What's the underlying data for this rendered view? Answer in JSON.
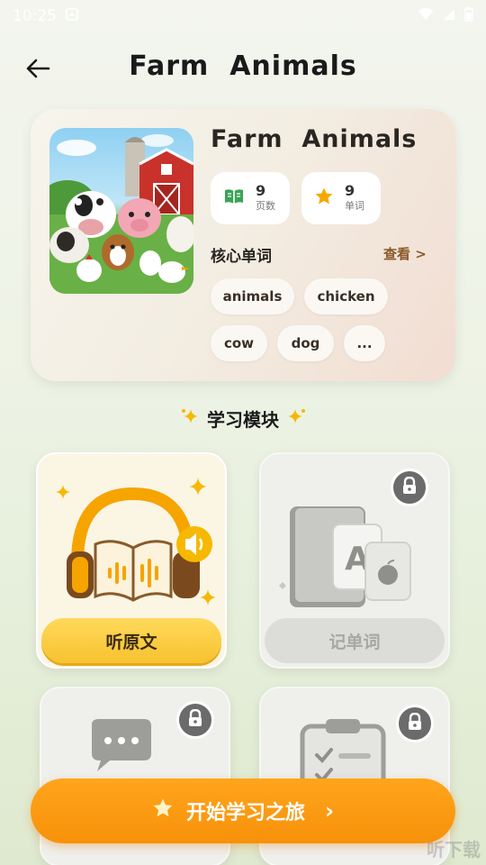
{
  "status_bar": {
    "time": "10:25"
  },
  "header": {
    "title": "Farm  Animals"
  },
  "book": {
    "title": "Farm  Animals",
    "stats": [
      {
        "value": "9",
        "label": "页数",
        "icon": "book-icon",
        "color": "#3aa457"
      },
      {
        "value": "9",
        "label": "单词",
        "icon": "star-icon",
        "color": "#f6a800"
      }
    ],
    "core_words_label": "核心单词",
    "view_label": "查看 >",
    "words": [
      "animals",
      "chicken",
      "cow",
      "dog",
      "..."
    ]
  },
  "section": {
    "title": "学习模块"
  },
  "modules": [
    {
      "label": "听原文",
      "locked": false,
      "icon": "headphones-book-icon"
    },
    {
      "label": "记单词",
      "locked": true,
      "icon": "flashcards-book-icon"
    },
    {
      "label": "",
      "locked": true,
      "icon": "chat-bubble-icon"
    },
    {
      "label": "",
      "locked": true,
      "icon": "clipboard-icon"
    }
  ],
  "start_button": {
    "label": "开始学习之旅",
    "arrow": "›"
  },
  "watermark": "听下载",
  "colors": {
    "accent": "#f7910a",
    "active_button": "#f7c230"
  }
}
